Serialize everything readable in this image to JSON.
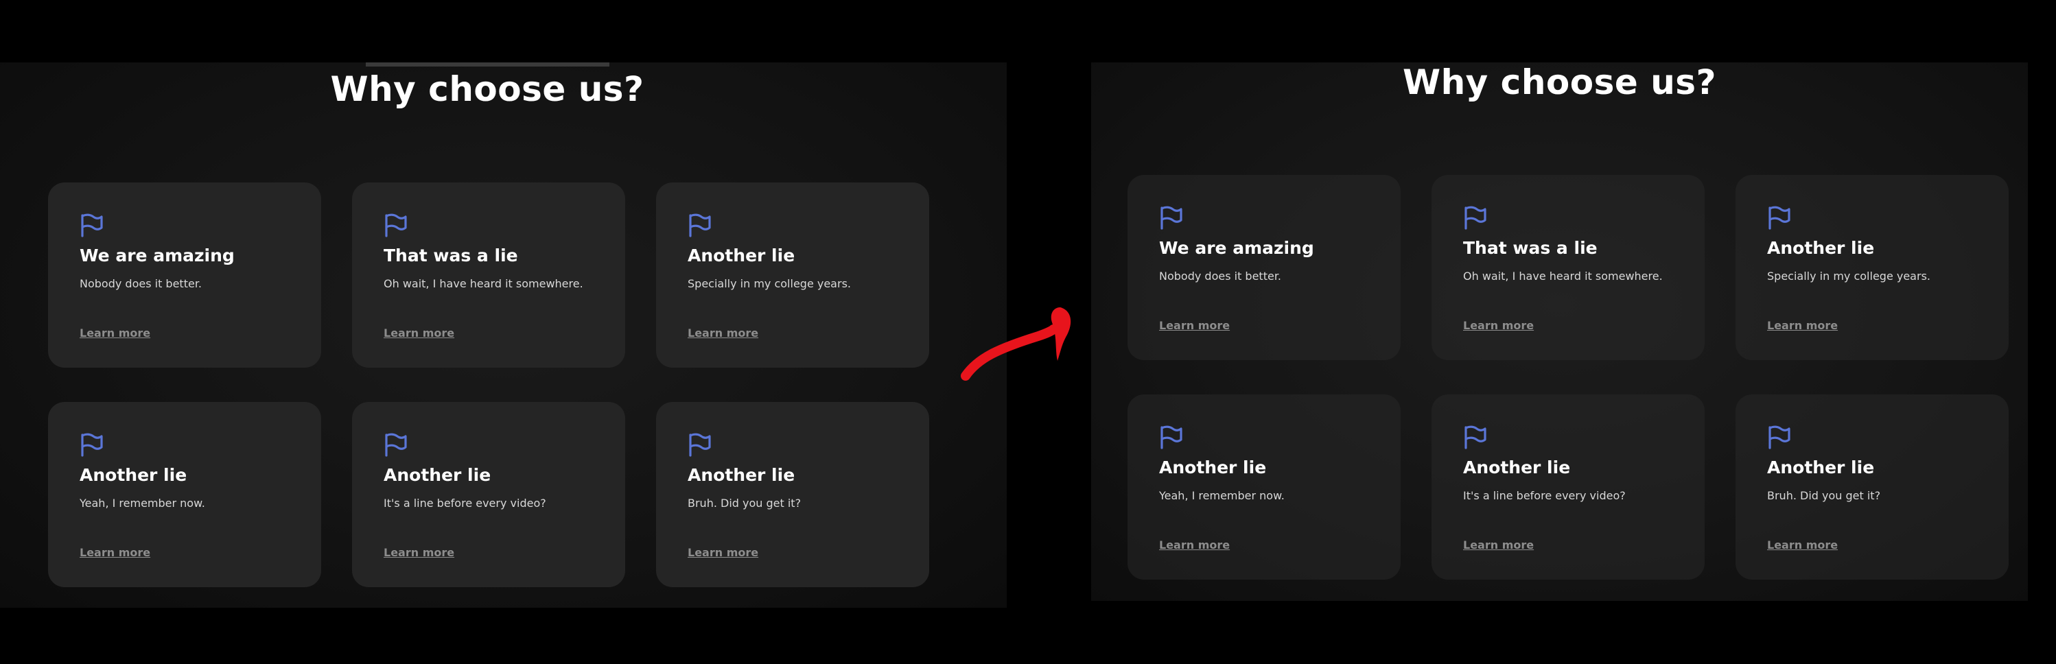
{
  "heading": "Why choose us?",
  "link_label": "Learn more",
  "accent_color": "#5b76d8",
  "arrow_color": "#e8141c",
  "cards": [
    {
      "title": "We are amazing",
      "desc": "Nobody does it better.",
      "icon": "flag-icon"
    },
    {
      "title": "That was a lie",
      "desc": "Oh wait, I have heard it somewhere.",
      "icon": "flag-icon"
    },
    {
      "title": "Another lie",
      "desc": "Specially in my college years.",
      "icon": "flag-icon"
    },
    {
      "title": "Another lie",
      "desc": "Yeah, I remember now.",
      "icon": "flag-icon"
    },
    {
      "title": "Another lie",
      "desc": "It's a line before every video?",
      "icon": "flag-icon"
    },
    {
      "title": "Another lie",
      "desc": "Bruh. Did you get it?",
      "icon": "flag-icon"
    }
  ]
}
